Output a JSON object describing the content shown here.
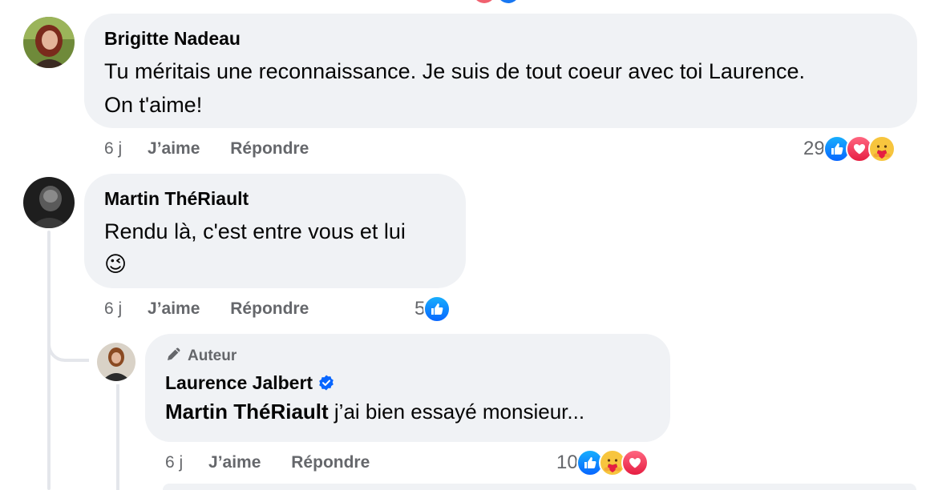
{
  "comments": [
    {
      "author": "Brigitte Nadeau",
      "text_line1": "Tu méritais une reconnaissance. Je suis de tout coeur avec toi Laurence.",
      "text_line2": "On t'aime!",
      "time": "6 j",
      "like_label": "J’aime",
      "reply_label": "Répondre",
      "reaction_count": "29",
      "reactions": [
        "like",
        "love",
        "care"
      ]
    },
    {
      "author": "Martin ThéRiault",
      "text_line1": "Rendu là, c'est entre vous et lui",
      "emoji": "😉",
      "time": "6 j",
      "like_label": "J’aime",
      "reply_label": "Répondre",
      "reaction_count": "5",
      "reactions": [
        "like"
      ]
    },
    {
      "badge": "Auteur",
      "author": "Laurence Jalbert",
      "mention": "Martin ThéRiault",
      "text_rest": " j’ai bien essayé monsieur...",
      "time": "6 j",
      "like_label": "J’aime",
      "reply_label": "Répondre",
      "reaction_count": "10",
      "reactions": [
        "like",
        "care",
        "love"
      ]
    }
  ],
  "colors": {
    "bubble": "#f0f2f5",
    "secondary_text": "#65676b",
    "like": "#0866ff",
    "love": "#e61e42",
    "care": "#f7c53e",
    "verified": "#0866ff"
  },
  "icons": [
    "pencil-icon",
    "verified-badge-icon",
    "like-icon",
    "love-icon",
    "care-icon"
  ]
}
